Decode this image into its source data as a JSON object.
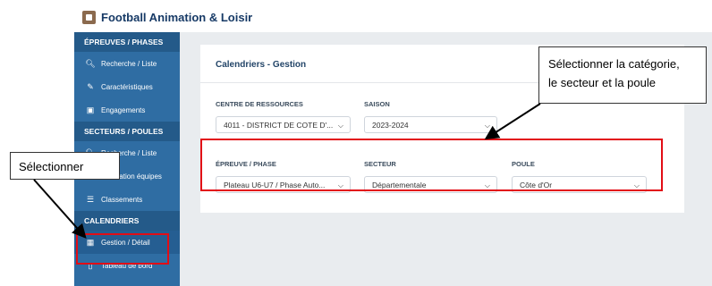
{
  "app": {
    "title": "Football Animation & Loisir"
  },
  "sidebar": {
    "sections": [
      {
        "title": "ÉPREUVES / PHASES",
        "items": [
          {
            "label": "Recherche / Liste",
            "icon": "search-icon"
          },
          {
            "label": "Caractéristiques",
            "icon": "pencil-icon"
          },
          {
            "label": "Engagements",
            "icon": "card-icon"
          }
        ]
      },
      {
        "title": "SECTEURS / POULES",
        "items": [
          {
            "label": "Recherche / Liste",
            "icon": "search-icon"
          },
          {
            "label": "Affectation équipes",
            "icon": "arrows-icon"
          },
          {
            "label": "Classements",
            "icon": "list-icon"
          }
        ]
      },
      {
        "title": "CALENDRIERS",
        "items": [
          {
            "label": "Gestion / Détail",
            "icon": "calendar-icon",
            "active": true
          },
          {
            "label": "Tableau de bord",
            "icon": "file-icon"
          }
        ]
      }
    ]
  },
  "main": {
    "card_title": "Calendriers - Gestion",
    "fields": {
      "centre": {
        "label": "CENTRE DE RESSOURCES",
        "value": "4011 - DISTRICT DE COTE D'..."
      },
      "saison": {
        "label": "SAISON",
        "value": "2023-2024"
      },
      "epreuve": {
        "label": "ÉPREUVE / PHASE",
        "value": "Plateau U6-U7 / Phase Auto..."
      },
      "secteur": {
        "label": "SECTEUR",
        "value": "Départementale"
      },
      "poule": {
        "label": "POULE",
        "value": "Côte d'Or"
      }
    }
  },
  "annotations": {
    "left_callout": "Sélectionner",
    "right_callout_line1": "Sélectionner la catégorie,",
    "right_callout_line2": "le secteur et la poule"
  }
}
